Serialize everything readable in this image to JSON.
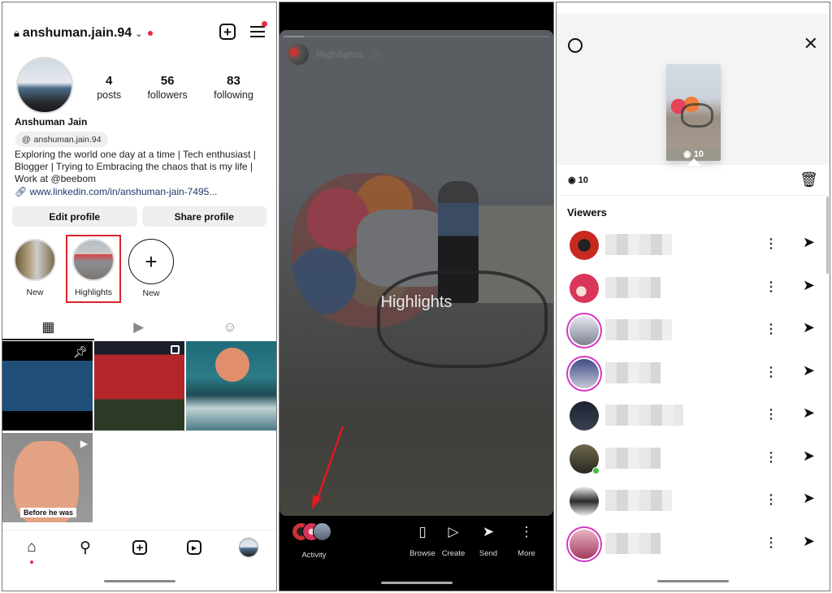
{
  "profile_screen": {
    "username": "anshuman.jain.94",
    "stats": [
      {
        "value": "4",
        "label": "posts"
      },
      {
        "value": "56",
        "label": "followers"
      },
      {
        "value": "83",
        "label": "following"
      }
    ],
    "full_name": "Anshuman Jain",
    "threads_handle": "anshuman.jain.94",
    "bio": "Exploring the world one day at a time | Tech enthusiast | Blogger | Trying to Embracing the chaos that is my life | Work at @beebom",
    "link": "www.linkedin.com/in/anshuman-jain-7495...",
    "buttons": {
      "edit": "Edit profile",
      "share": "Share profile"
    },
    "highlights": [
      {
        "label": "New"
      },
      {
        "label": "Highlights"
      },
      {
        "label": "New"
      }
    ],
    "grid_posts": [
      {
        "type": "pinned",
        "caption": ""
      },
      {
        "type": "carousel",
        "caption": ""
      },
      {
        "type": "image",
        "caption": ""
      },
      {
        "type": "reel",
        "caption": "Before he was"
      }
    ],
    "accent_color": "#e8294b",
    "highlight_box_color": "#d6262b"
  },
  "story_screen": {
    "header_title": "Highlights",
    "header_time": "2h",
    "overlay_text": "Highlights",
    "activity_label": "Activity",
    "actions": [
      {
        "label": "Browse",
        "icon": "browse-icon"
      },
      {
        "label": "Create",
        "icon": "reels-icon"
      },
      {
        "label": "Send",
        "icon": "send-icon"
      },
      {
        "label": "More",
        "icon": "more-vertical-icon"
      }
    ],
    "progress": 0.08
  },
  "viewers_screen": {
    "thumb_views": "10",
    "view_count": "10",
    "viewers_title": "Viewers",
    "viewers": [
      {
        "ring": false,
        "online": false
      },
      {
        "ring": false,
        "online": false
      },
      {
        "ring": true,
        "online": false
      },
      {
        "ring": true,
        "online": false
      },
      {
        "ring": false,
        "online": false
      },
      {
        "ring": false,
        "online": true
      },
      {
        "ring": false,
        "online": false
      },
      {
        "ring": true,
        "online": false
      }
    ]
  }
}
